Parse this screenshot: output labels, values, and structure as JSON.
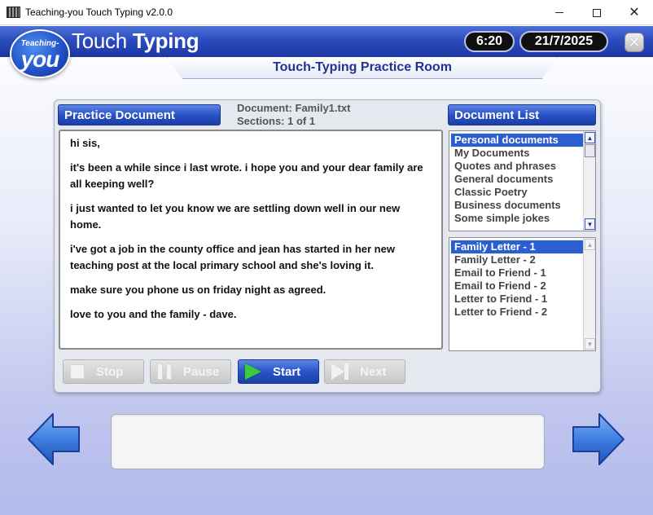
{
  "window": {
    "title": "Teaching-you Touch Typing v2.0.0",
    "close_glyph": "✕"
  },
  "header": {
    "logo_top": "Teaching-",
    "logo_bottom": "you",
    "title_light": "Touch ",
    "title_bold": "Typing",
    "time": "6:20",
    "date": "21/7/2025",
    "close_glyph": "✕"
  },
  "room": {
    "title": "Touch-Typing Practice Room"
  },
  "practice": {
    "header": "Practice Document",
    "document_label": "Document: Family1.txt",
    "sections_label": "Sections: 1 of  1",
    "paragraphs": [
      "hi sis,",
      "it's been a while since i last wrote. i hope you and your dear family are all keeping well?",
      "i just wanted to let you know we are settling down well in our new home.",
      "i've got a job in the county office and jean has started in her new teaching post at the local primary school and she's loving it.",
      "make sure you phone us on friday night as agreed.",
      "love to you and the family - dave."
    ]
  },
  "document_list": {
    "header": "Document List",
    "categories": [
      "Personal documents",
      "My Documents",
      "Quotes and phrases",
      "General documents",
      "Classic Poetry",
      "Business documents",
      "Some simple jokes"
    ],
    "selected_category": 0,
    "documents": [
      "Family Letter - 1",
      "Family Letter - 2",
      "Email to Friend - 1",
      "Email to Friend - 2",
      "Letter to Friend - 1",
      "Letter to Friend - 2"
    ],
    "selected_document": 0,
    "scroll_up_glyph": "▲",
    "scroll_down_glyph": "▼"
  },
  "controls": {
    "stop": "Stop",
    "pause": "Pause",
    "start": "Start",
    "next": "Next"
  },
  "icons": {
    "back": "arrow-left-icon",
    "forward": "arrow-right-icon"
  },
  "colors": {
    "header_blue": "#2c4cbf",
    "accent_blue": "#2d5ecf",
    "start_green": "#3ec93e"
  }
}
